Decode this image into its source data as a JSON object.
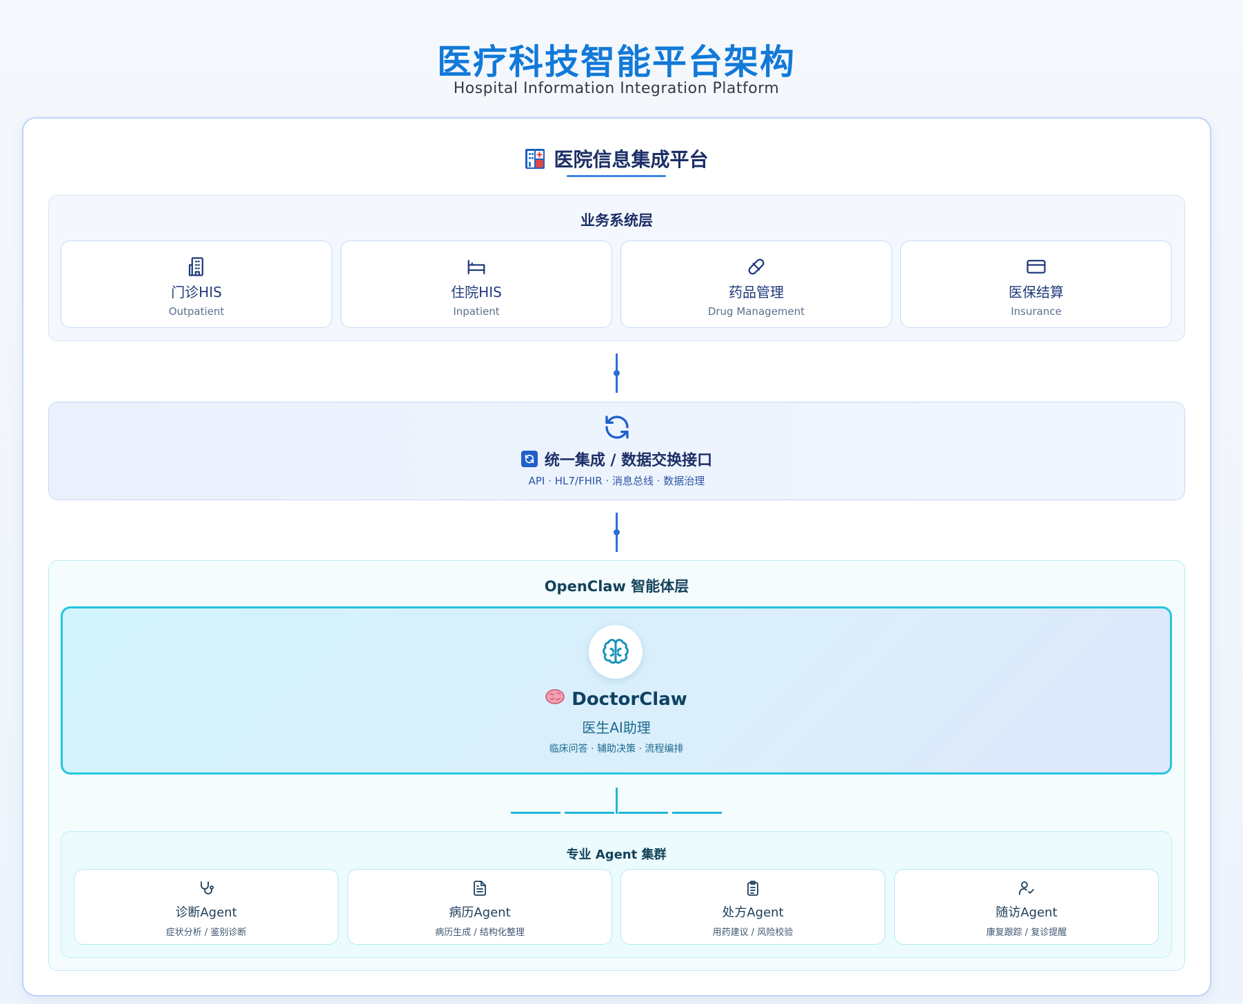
{
  "header": {
    "title": "医疗科技智能平台架构",
    "subtitle": "Hospital Information Integration Platform"
  },
  "platform": {
    "title": "医院信息集成平台",
    "icon": "hospital-icon"
  },
  "business_layer": {
    "title": "业务系统层",
    "cards": [
      {
        "cn": "门诊HIS",
        "en": "Outpatient",
        "icon": "building-icon"
      },
      {
        "cn": "住院HIS",
        "en": "Inpatient",
        "icon": "bed-icon"
      },
      {
        "cn": "药品管理",
        "en": "Drug Management",
        "icon": "pill-icon"
      },
      {
        "cn": "医保结算",
        "en": "Insurance",
        "icon": "card-icon"
      }
    ]
  },
  "integration": {
    "title": "统一集成 / 数据交换接口",
    "subtitle": "API · HL7/FHIR · 消息总线 · 数据治理",
    "icon": "sync-icon"
  },
  "openclaw_layer": {
    "title": "OpenClaw 智能体层",
    "doctorclaw": {
      "name": "DoctorClaw",
      "role": "医生AI助理",
      "subtitle": "临床问答 · 辅助决策 · 流程编排",
      "icon": "brain-icon"
    },
    "agent_cluster": {
      "title": "专业 Agent 集群",
      "agents": [
        {
          "name": "诊断Agent",
          "desc": "症状分析 / 鉴别诊断",
          "icon": "stethoscope-icon"
        },
        {
          "name": "病历Agent",
          "desc": "病历生成 / 结构化整理",
          "icon": "document-icon"
        },
        {
          "name": "处方Agent",
          "desc": "用药建议 / 风险校验",
          "icon": "clipboard-icon"
        },
        {
          "name": "随访Agent",
          "desc": "康复跟踪 / 复诊提醒",
          "icon": "user-check-icon"
        }
      ]
    }
  },
  "colors": {
    "title_blue": "#1279d8",
    "connector_blue": "#2b6fd6",
    "cyan_accent": "#22c5e0"
  }
}
